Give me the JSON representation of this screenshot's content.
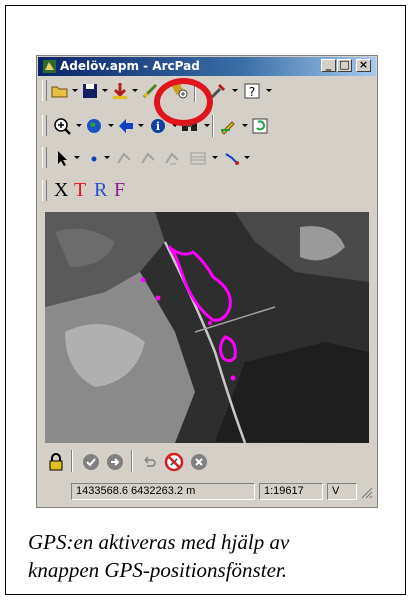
{
  "window": {
    "title": "Adelöv.apm - ArcPad",
    "controls": {
      "minimize": "_",
      "maximize": "□",
      "close": "×"
    }
  },
  "toolbars": {
    "main": [
      "open-folder-icon",
      "save-icon",
      "add-layer-icon",
      "gps-tool-icon",
      "gps-position-window-icon",
      "tools-icon",
      "help-icon"
    ],
    "navigation": [
      "zoom-in-icon",
      "globe-icon",
      "back-arrow-icon",
      "identify-icon",
      "find-icon",
      "pen-icon",
      "refresh-icon"
    ],
    "edit": [
      "pointer-icon",
      "point-icon",
      "vertex-icon",
      "vertex-add-icon",
      "vertex-move-icon",
      "attribute-table-icon",
      "polyline-icon"
    ],
    "markup": [
      {
        "label": "X",
        "color": "#000000"
      },
      {
        "label": "T",
        "color": "#e0141c"
      },
      {
        "label": "R",
        "color": "#2a4fd0"
      },
      {
        "label": "F",
        "color": "#8a2090"
      }
    ]
  },
  "highlight": {
    "target": "gps-position-window-icon",
    "color": "#e0141c"
  },
  "map": {
    "feature_color": "#ff00ff",
    "background": "aerial-photo"
  },
  "bottom_toolbar": [
    "lock-icon",
    "check-icon",
    "forward-icon",
    "undo-icon",
    "no-gps-icon",
    "cancel-icon"
  ],
  "status": {
    "coordinates": "1433568.6 6432263.2 m",
    "scale": "1:19617",
    "extra": "V"
  },
  "caption": {
    "line1": "GPS:en aktiveras med hjälp av",
    "line2": "knappen GPS-positionsfönster."
  }
}
